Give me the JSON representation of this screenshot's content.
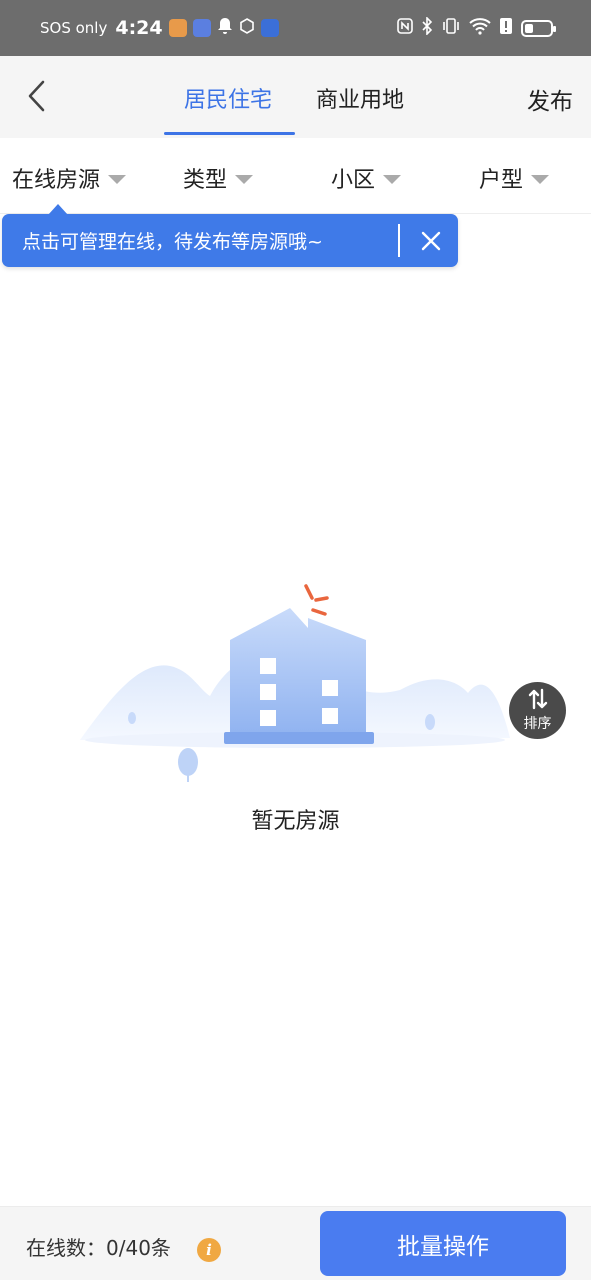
{
  "status_bar": {
    "carrier": "SOS only",
    "time": "4:24"
  },
  "header": {
    "tabs": [
      {
        "label": "居民住宅",
        "active": true
      },
      {
        "label": "商业用地",
        "active": false
      }
    ],
    "publish_label": "发布"
  },
  "filters": [
    {
      "label": "在线房源"
    },
    {
      "label": "类型"
    },
    {
      "label": "小区"
    },
    {
      "label": "户型"
    }
  ],
  "tooltip": {
    "text": "点击可管理在线，待发布等房源哦~"
  },
  "empty_state": {
    "text": "暂无房源"
  },
  "sort_button": {
    "label": "排序"
  },
  "footer": {
    "online_count_label": "在线数：",
    "online_count_value": "0/40条",
    "batch_button_label": "批量操作"
  },
  "colors": {
    "accent": "#3d74e6",
    "tooltip_bg": "#3f7ae8",
    "button_bg": "#4a7cf0",
    "info_icon": "#f0a842",
    "sort_button_bg": "#4a4a4a",
    "status_bar_bg": "#6d6d6d"
  }
}
